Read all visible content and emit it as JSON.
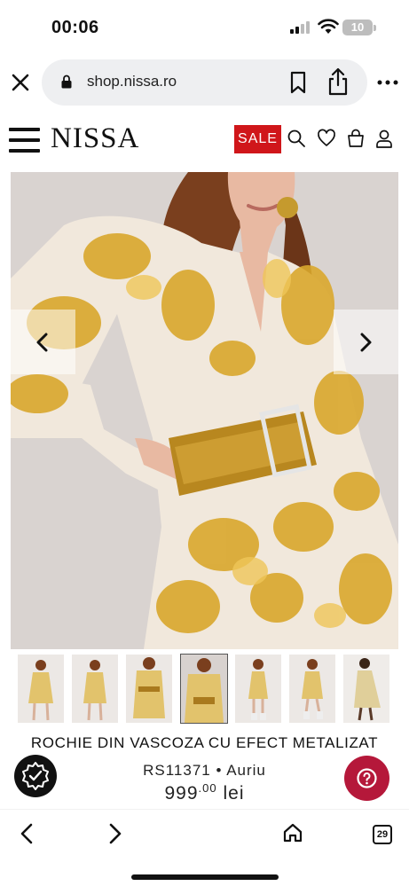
{
  "status_bar": {
    "time": "00:06",
    "battery": "10"
  },
  "browser": {
    "url": "shop.nissa.ro",
    "tab_count": "29"
  },
  "site": {
    "logo": "NISSA",
    "sale_label": "SALE"
  },
  "product": {
    "title": "ROCHIE DIN VASCOZA CU EFECT METALIZAT",
    "sku_color": "RS11371 • Auriu",
    "price_main": "999",
    "price_decimals": ".00",
    "currency": "lei"
  },
  "gallery": {
    "thumbnail_count": 7,
    "active_index": 3
  },
  "colors": {
    "sale": "#d0161a",
    "help_button": "#b5183a",
    "gold": "#d9a72c"
  }
}
